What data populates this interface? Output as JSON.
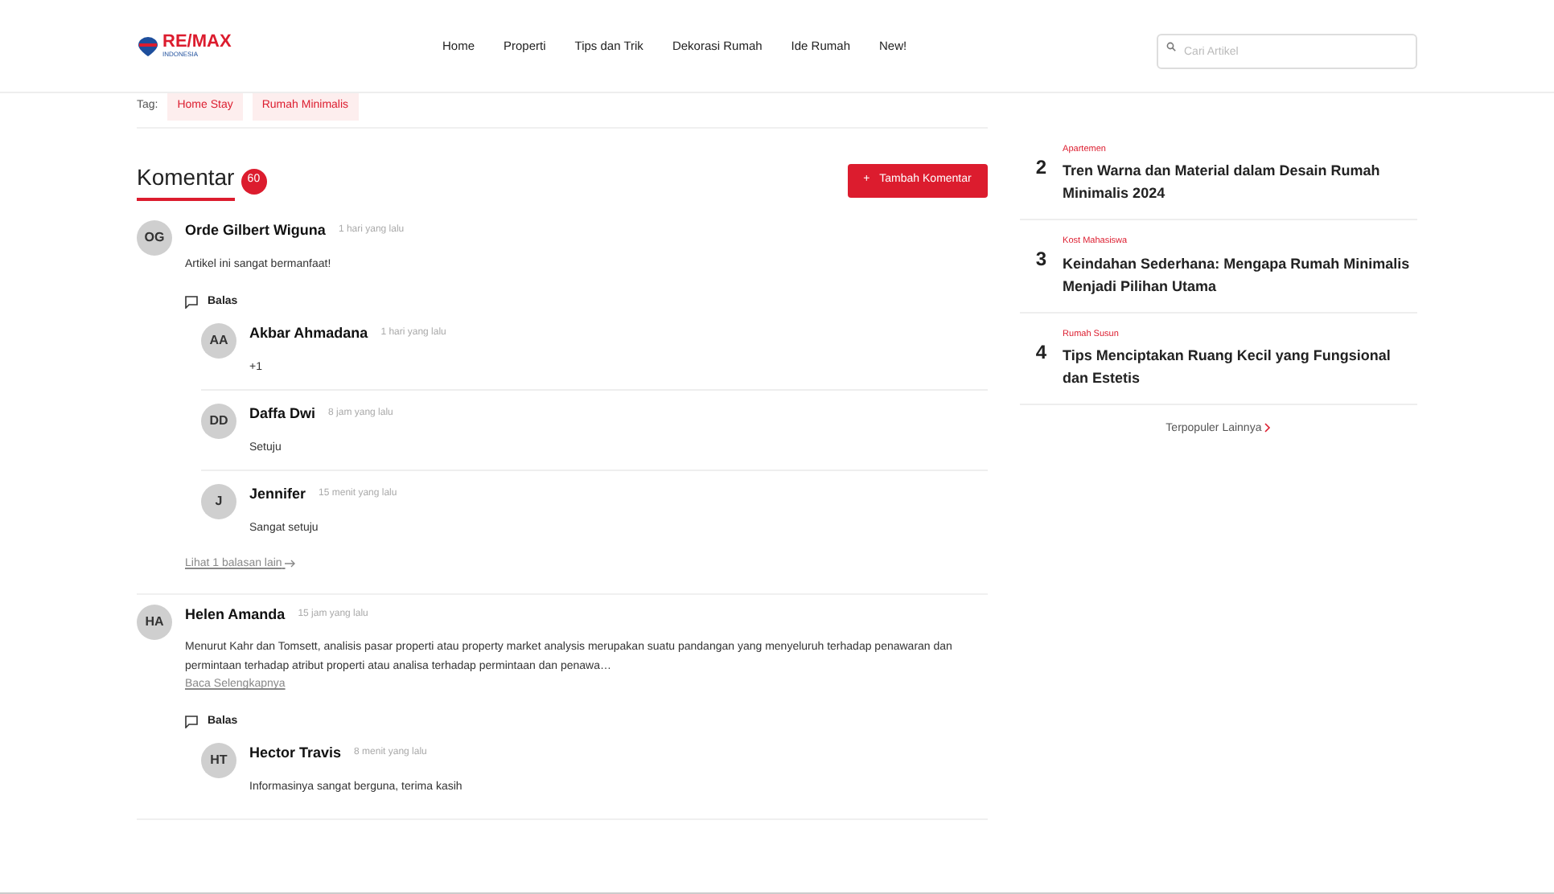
{
  "header": {
    "logo": "RE/MAX",
    "logo_sub": "INDONESIA",
    "nav": [
      "Home",
      "Properti",
      "Tips dan Trik",
      "Dekorasi Rumah",
      "Ide Rumah",
      "New!"
    ],
    "search": {
      "placeholder": "Cari Artikel"
    }
  },
  "tags": {
    "label": "Tag:",
    "items": [
      "Home Stay",
      "Rumah Minimalis"
    ]
  },
  "comments_section": {
    "title": "Komentar",
    "count": "60",
    "add_button": "Tambah Komentar",
    "add_icon": "+",
    "comments": [
      {
        "initials": "OG",
        "name": "Orde Gilbert Wiguna",
        "time": "1 hari yang lalu",
        "text": "Artikel ini sangat bermanfaat!",
        "reply_label": "Balas",
        "replies": [
          {
            "initials": "AA",
            "name": "Akbar Ahmadana",
            "time": "1 hari yang lalu",
            "text": "+1"
          },
          {
            "initials": "DD",
            "name": "Daffa Dwi",
            "time": "8 jam yang lalu",
            "text": "Setuju"
          },
          {
            "initials": "J",
            "name": "Jennifer",
            "time": "15 menit yang lalu",
            "text": "Sangat setuju"
          }
        ],
        "more_replies": "Lihat 1 balasan lain"
      },
      {
        "initials": "HA",
        "name": "Helen Amanda",
        "time": "15 jam yang lalu",
        "text": "Menurut Kahr dan Tomsett, analisis pasar properti atau property market analysis merupakan suatu pandangan yang menyeluruh terhadap penawaran dan permintaan terhadap atribut properti atau analisa terhadap permintaan dan penawa…",
        "read_more": "Baca Selengkapnya",
        "reply_label": "Balas",
        "replies": [
          {
            "initials": "HT",
            "name": "Hector Travis",
            "time": "8 menit yang lalu",
            "text": "Informasinya sangat berguna, terima kasih"
          }
        ]
      }
    ]
  },
  "popular": {
    "items": [
      {
        "rank": "2",
        "category": "Apartemen",
        "title": "Tren Warna dan Material dalam Desain Rumah Minimalis 2024"
      },
      {
        "rank": "3",
        "category": "Kost Mahasiswa",
        "title": "Keindahan Sederhana: Mengapa Rumah Minimalis Menjadi Pilihan Utama"
      },
      {
        "rank": "4",
        "category": "Rumah Susun",
        "title": "Tips Menciptakan Ruang Kecil yang Fungsional dan Estetis"
      }
    ],
    "more_link": "Terpopuler Lainnya"
  }
}
